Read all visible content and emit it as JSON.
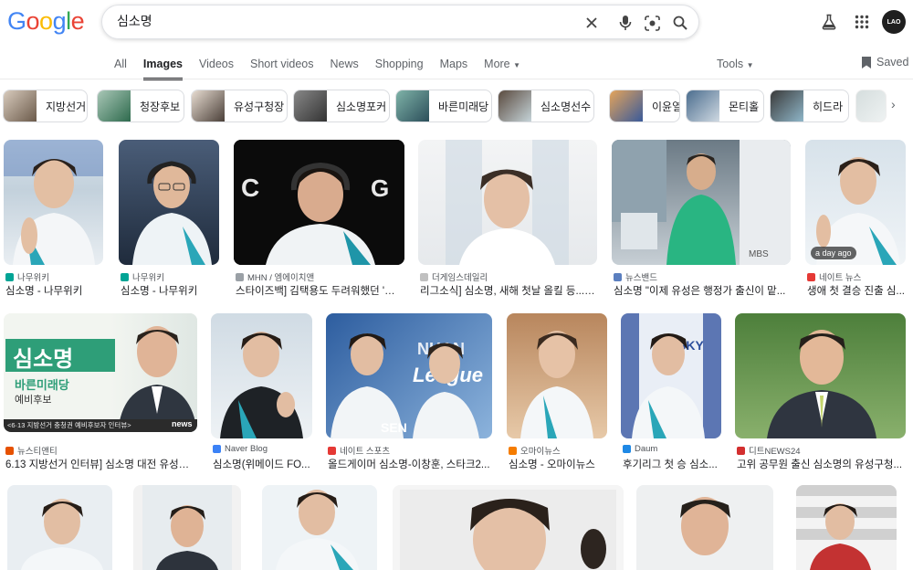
{
  "header": {
    "logo_letters": [
      "G",
      "o",
      "o",
      "g",
      "l",
      "e"
    ],
    "logo_colors": [
      "#4285f4",
      "#ea4335",
      "#fbbc05",
      "#4285f4",
      "#34a853",
      "#ea4335"
    ],
    "query": "심소명",
    "avatar_text": "LAO"
  },
  "tabs": [
    "All",
    "Images",
    "Videos",
    "Short videos",
    "News",
    "Shopping",
    "Maps",
    "More"
  ],
  "active_tab": "Images",
  "tools_label": "Tools",
  "saved_label": "Saved",
  "chips": [
    "지방선거",
    "청장후보",
    "유성구청장",
    "심소명포커",
    "바른미래당",
    "심소명선수",
    "이윤열",
    "몬티홀",
    "히드라"
  ],
  "row1": [
    {
      "source": "나무위키",
      "title": "심소명 - 나무위키",
      "fav": "#00a495"
    },
    {
      "source": "나무위키",
      "title": "심소명 - 나무위키",
      "fav": "#00a495"
    },
    {
      "source": "MHN / 엠에이치앤",
      "title": "스타이즈백] 김택용도 두려워했던 '맹 ...",
      "fav": "#9aa0a6"
    },
    {
      "source": "더게임스데일리",
      "title": "리그소식] 심소명, 새해 첫날 올킬 등... <...",
      "fav": "#c0c0c0"
    },
    {
      "source": "뉴스밴드",
      "title": "심소명 \"이제 유성은 행정가 출신이 맡...",
      "fav": "#5b7fbf"
    },
    {
      "source": "네이트 뉴스",
      "title": "생애 첫 결승 진출 심...",
      "fav": "#e53935",
      "badge": "a day ago"
    }
  ],
  "row2": [
    {
      "source": "뉴스티앤티",
      "title": "6.13 지방선거 인터뷰] 심소명 대전 유성구...",
      "fav": "#e65100"
    },
    {
      "source": "Naver Blog",
      "title": "심소명(위메이드 FO...",
      "fav": "#3b82f6"
    },
    {
      "source": "네이트 스포츠",
      "title": "올드게이머 심소명-이창훈, 스타크2...",
      "fav": "#e53935"
    },
    {
      "source": "오마이뉴스",
      "title": "심소명 - 오마이뉴스",
      "fav": "#f57c00"
    },
    {
      "source": "Daum",
      "title": "후기리그 첫 승 심소...",
      "fav": "#1e88e5"
    },
    {
      "source": "디트NEWS24",
      "title": "고위 공무원 출신 심소명의 유성구청...",
      "fav": "#d32f2f"
    }
  ],
  "poster_text": {
    "name": "심소명",
    "party": "바른미래당",
    "role": "예비후보",
    "caption": "<6·13 지방선거 충청권 예비후보자 인터뷰>",
    "brand": "news"
  },
  "colors": {
    "accent": "#1a73e8",
    "text": "#202124",
    "muted": "#5f6368",
    "border": "#dadce0"
  }
}
